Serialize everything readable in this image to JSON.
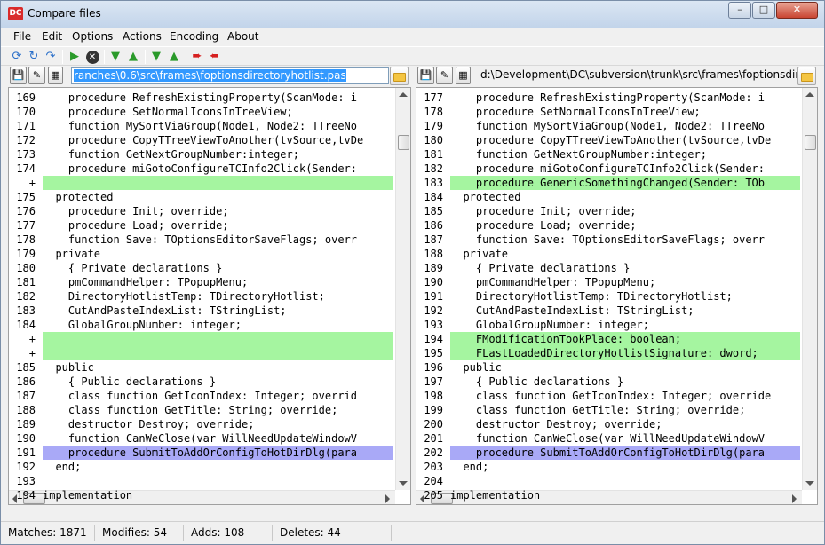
{
  "window": {
    "title": "Compare files",
    "app_icon": "DC"
  },
  "menu": [
    "File",
    "Edit",
    "Options",
    "Actions",
    "Encoding",
    "About"
  ],
  "toolbar_icons": [
    "reload-icon",
    "refresh-icon",
    "save-icon",
    "start-compare-icon",
    "stop-icon",
    "first-diff-icon",
    "prev-diff-icon",
    "next-diff-icon",
    "last-diff-icon",
    "copy-right-icon",
    "copy-left-icon"
  ],
  "left": {
    "path": "ranches\\0.6\\src\\frames\\foptionsdirectoryhotlist.pas",
    "lines": [
      {
        "n": "169",
        "t": "    procedure RefreshExistingProperty(ScanMode: i",
        "k": ""
      },
      {
        "n": "170",
        "t": "    procedure SetNormalIconsInTreeView;",
        "k": ""
      },
      {
        "n": "171",
        "t": "    function MySortViaGroup(Node1, Node2: TTreeNo",
        "k": ""
      },
      {
        "n": "172",
        "t": "    procedure CopyTTreeViewToAnother(tvSource,tvDe",
        "k": ""
      },
      {
        "n": "173",
        "t": "    function GetNextGroupNumber:integer;",
        "k": ""
      },
      {
        "n": "174",
        "t": "    procedure miGotoConfigureTCInfo2Click(Sender:",
        "k": ""
      },
      {
        "n": "+",
        "t": "",
        "k": "add"
      },
      {
        "n": "175",
        "t": "  protected",
        "k": ""
      },
      {
        "n": "176",
        "t": "    procedure Init; override;",
        "k": ""
      },
      {
        "n": "177",
        "t": "    procedure Load; override;",
        "k": ""
      },
      {
        "n": "178",
        "t": "    function Save: TOptionsEditorSaveFlags; overr",
        "k": ""
      },
      {
        "n": "179",
        "t": "  private",
        "k": ""
      },
      {
        "n": "180",
        "t": "    { Private declarations }",
        "k": ""
      },
      {
        "n": "181",
        "t": "    pmCommandHelper: TPopupMenu;",
        "k": ""
      },
      {
        "n": "182",
        "t": "    DirectoryHotlistTemp: TDirectoryHotlist;",
        "k": ""
      },
      {
        "n": "183",
        "t": "    CutAndPasteIndexList: TStringList;",
        "k": ""
      },
      {
        "n": "184",
        "t": "    GlobalGroupNumber: integer;",
        "k": ""
      },
      {
        "n": "+",
        "t": "",
        "k": "add"
      },
      {
        "n": "+",
        "t": "",
        "k": "add"
      },
      {
        "n": "185",
        "t": "  public",
        "k": ""
      },
      {
        "n": "186",
        "t": "    { Public declarations }",
        "k": ""
      },
      {
        "n": "187",
        "t": "    class function GetIconIndex: Integer; overrid",
        "k": ""
      },
      {
        "n": "188",
        "t": "    class function GetTitle: String; override;",
        "k": ""
      },
      {
        "n": "189",
        "t": "    destructor Destroy; override;",
        "k": ""
      },
      {
        "n": "190",
        "t": "    function CanWeClose(var WillNeedUpdateWindowV",
        "k": ""
      },
      {
        "n": "191",
        "t": "    procedure SubmitToAddOrConfigToHotDirDlg(para",
        "k": "mod"
      },
      {
        "n": "192",
        "t": "  end;",
        "k": ""
      },
      {
        "n": "193",
        "t": "",
        "k": ""
      },
      {
        "n": "194",
        "t": "implementation",
        "k": ""
      }
    ]
  },
  "right": {
    "path": "d:\\Development\\DC\\subversion\\trunk\\src\\frames\\foptionsdirector",
    "lines": [
      {
        "n": "177",
        "t": "    procedure RefreshExistingProperty(ScanMode: i",
        "k": ""
      },
      {
        "n": "178",
        "t": "    procedure SetNormalIconsInTreeView;",
        "k": ""
      },
      {
        "n": "179",
        "t": "    function MySortViaGroup(Node1, Node2: TTreeNo",
        "k": ""
      },
      {
        "n": "180",
        "t": "    procedure CopyTTreeViewToAnother(tvSource,tvDe",
        "k": ""
      },
      {
        "n": "181",
        "t": "    function GetNextGroupNumber:integer;",
        "k": ""
      },
      {
        "n": "182",
        "t": "    procedure miGotoConfigureTCInfo2Click(Sender:",
        "k": ""
      },
      {
        "n": "183",
        "t": "    procedure GenericSomethingChanged(Sender: TOb",
        "k": "add"
      },
      {
        "n": "184",
        "t": "  protected",
        "k": ""
      },
      {
        "n": "185",
        "t": "    procedure Init; override;",
        "k": ""
      },
      {
        "n": "186",
        "t": "    procedure Load; override;",
        "k": ""
      },
      {
        "n": "187",
        "t": "    function Save: TOptionsEditorSaveFlags; overr",
        "k": ""
      },
      {
        "n": "188",
        "t": "  private",
        "k": ""
      },
      {
        "n": "189",
        "t": "    { Private declarations }",
        "k": ""
      },
      {
        "n": "190",
        "t": "    pmCommandHelper: TPopupMenu;",
        "k": ""
      },
      {
        "n": "191",
        "t": "    DirectoryHotlistTemp: TDirectoryHotlist;",
        "k": ""
      },
      {
        "n": "192",
        "t": "    CutAndPasteIndexList: TStringList;",
        "k": ""
      },
      {
        "n": "193",
        "t": "    GlobalGroupNumber: integer;",
        "k": ""
      },
      {
        "n": "194",
        "t": "    FModificationTookPlace: boolean;",
        "k": "add"
      },
      {
        "n": "195",
        "t": "    FLastLoadedDirectoryHotlistSignature: dword;",
        "k": "add"
      },
      {
        "n": "196",
        "t": "  public",
        "k": ""
      },
      {
        "n": "197",
        "t": "    { Public declarations }",
        "k": ""
      },
      {
        "n": "198",
        "t": "    class function GetIconIndex: Integer; override",
        "k": ""
      },
      {
        "n": "199",
        "t": "    class function GetTitle: String; override;",
        "k": ""
      },
      {
        "n": "200",
        "t": "    destructor Destroy; override;",
        "k": ""
      },
      {
        "n": "201",
        "t": "    function CanWeClose(var WillNeedUpdateWindowV",
        "k": ""
      },
      {
        "n": "202",
        "t": "    procedure SubmitToAddOrConfigToHotDirDlg(para",
        "k": "mod"
      },
      {
        "n": "203",
        "t": "  end;",
        "k": ""
      },
      {
        "n": "204",
        "t": "",
        "k": ""
      },
      {
        "n": "205",
        "t": "implementation",
        "k": ""
      }
    ]
  },
  "status": {
    "matches": "Matches: 1871",
    "modifies": "Modifies: 54",
    "adds": "Adds: 108",
    "deletes": "Deletes: 44"
  },
  "colors": {
    "added": "#a5f5a0",
    "modified": "#a9a9f7",
    "selection": "#3399ff"
  }
}
